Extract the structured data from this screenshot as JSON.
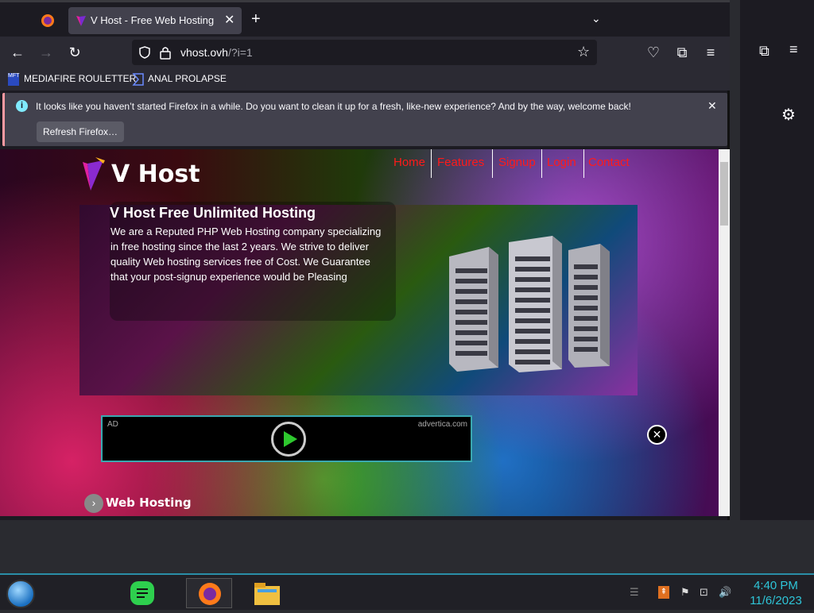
{
  "browser": {
    "active_tab_title": "V Host - Free Web Hosting with",
    "url_main": "vhost.ovh",
    "url_rest": "/?i=1",
    "bookmarks": [
      "MEDIAFIRE ROULETTER",
      "ANAL PROLAPSE"
    ],
    "bookmark_icons": [
      "MFT",
      ""
    ],
    "notification": {
      "message": "It looks like you haven’t started Firefox in a while. Do you want to clean it up for a fresh, like-new experience? And by the way, welcome back!",
      "button": "Refresh Firefox…"
    }
  },
  "site": {
    "logo": "V Host",
    "menu": [
      "Home",
      "Features",
      "Signup",
      "Login",
      "Contact"
    ],
    "hero_title": "V Host Free Unlimited Hosting",
    "hero_text": "We are a Reputed PHP Web Hosting company specializing in free hosting since the last 2 years. We strive to deliver quality Web hosting services free of Cost. We Guarantee that your post-signup experience would be Pleasing",
    "ad_label": "AD",
    "ad_source": "advertica.com",
    "section_label": "Web Hosting"
  },
  "taskbar": {
    "time": "4:40 PM",
    "date": "11/6/2023"
  },
  "colors": {
    "menu": "#ff1a1a",
    "clock": "#2ec5d8",
    "accent": "#2a8ea8"
  }
}
